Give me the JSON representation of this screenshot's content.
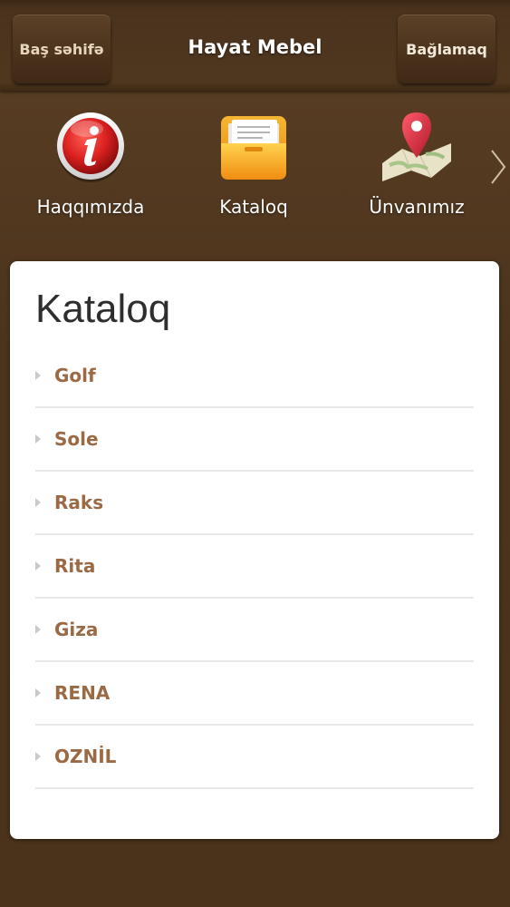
{
  "header": {
    "back_label": "Baş səhifə",
    "title": "Hayat Mebel",
    "contact_label": "Bağlamaq"
  },
  "iconbar": {
    "items": [
      {
        "label": "Haqqımızda",
        "icon": "info-icon"
      },
      {
        "label": "Kataloq",
        "icon": "folder-icon"
      },
      {
        "label": "Ünvanımız",
        "icon": "map-pin-icon"
      }
    ],
    "next_icon": "chevron-right-icon"
  },
  "panel": {
    "title": "Kataloq",
    "items": [
      "Golf",
      "Sole",
      "Raks",
      "Rita",
      "Giza",
      "RENA",
      "OZNİL"
    ]
  },
  "colors": {
    "background": "#4b331c",
    "link_text": "#9b6a45",
    "info_red": "#d9201f",
    "folder_orange": "#f6a623"
  }
}
